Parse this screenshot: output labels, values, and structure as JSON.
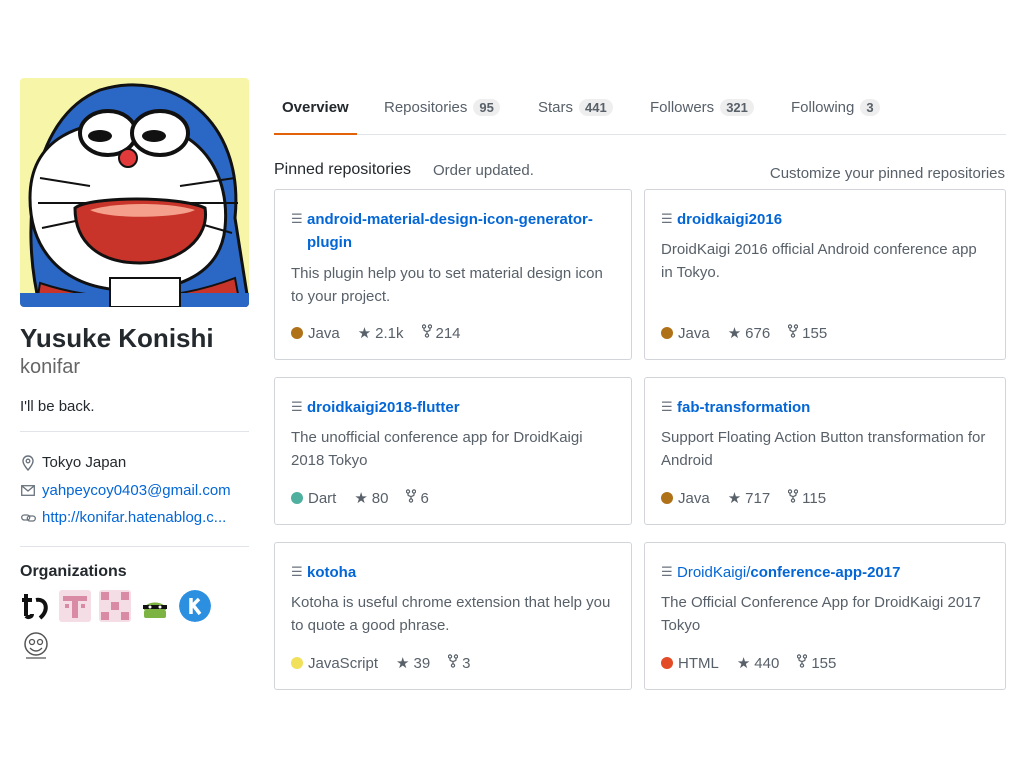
{
  "profile": {
    "fullname": "Yusuke Konishi",
    "username": "konifar",
    "bio": "I'll be back.",
    "location": "Tokyo Japan",
    "email": "yahpeycoy0403@gmail.com",
    "website": "http://konifar.hatenablog.c..."
  },
  "organizations": {
    "title": "Organizations",
    "items": [
      "org-tb",
      "org-pink-t",
      "org-pink-pattern",
      "org-android",
      "org-k",
      "org-sketch"
    ]
  },
  "tabs": [
    {
      "label": "Overview",
      "count": null,
      "selected": true
    },
    {
      "label": "Repositories",
      "count": "95"
    },
    {
      "label": "Stars",
      "count": "441"
    },
    {
      "label": "Followers",
      "count": "321"
    },
    {
      "label": "Following",
      "count": "3"
    }
  ],
  "pinned": {
    "title": "Pinned repositories",
    "status": "Order updated.",
    "customize": "Customize your pinned repositories",
    "repos": [
      {
        "owner": "",
        "name": "android-material-design-icon-generator-plugin",
        "description": "This plugin help you to set material design icon to your project.",
        "language": "Java",
        "color": "#b07219",
        "stars": "2.1k",
        "forks": "214"
      },
      {
        "owner": "",
        "name": "droidkaigi2016",
        "description": "DroidKaigi 2016 official Android conference app in Tokyo.",
        "language": "Java",
        "color": "#b07219",
        "stars": "676",
        "forks": "155"
      },
      {
        "owner": "",
        "name": "droidkaigi2018-flutter",
        "description": "The unofficial conference app for DroidKaigi 2018 Tokyo",
        "language": "Dart",
        "color": "#4fb0a0",
        "stars": "80",
        "forks": "6"
      },
      {
        "owner": "",
        "name": "fab-transformation",
        "description": "Support Floating Action Button transformation for Android",
        "language": "Java",
        "color": "#b07219",
        "stars": "717",
        "forks": "115"
      },
      {
        "owner": "",
        "name": "kotoha",
        "description": "Kotoha is useful chrome extension that help you to quote a good phrase.",
        "language": "JavaScript",
        "color": "#f1e05a",
        "stars": "39",
        "forks": "3"
      },
      {
        "owner": "DroidKaigi/",
        "name": "conference-app-2017",
        "description": "The Official Conference App for DroidKaigi 2017 Tokyo",
        "language": "HTML",
        "color": "#e34c26",
        "stars": "440",
        "forks": "155"
      }
    ]
  }
}
